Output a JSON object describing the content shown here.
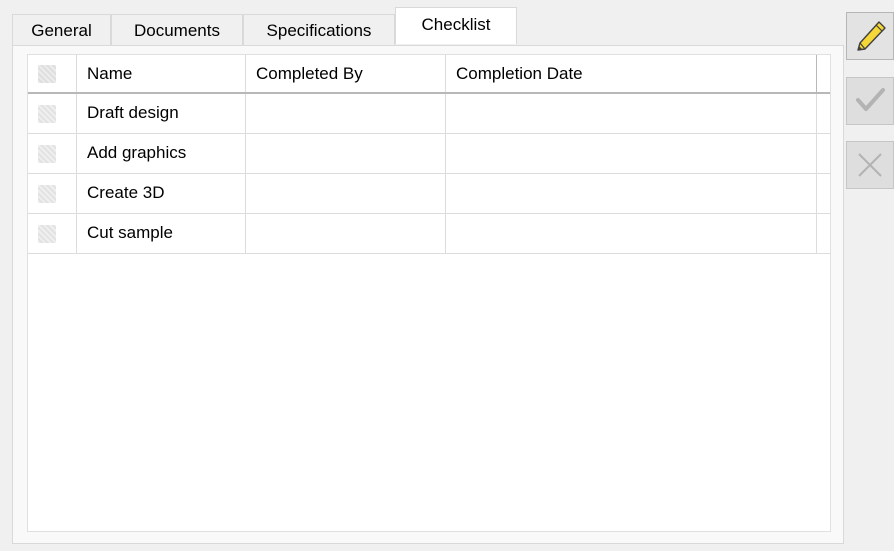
{
  "tabs": [
    {
      "label": "General",
      "active": false
    },
    {
      "label": "Documents",
      "active": false
    },
    {
      "label": "Specifications",
      "active": false
    },
    {
      "label": "Checklist",
      "active": true
    }
  ],
  "grid": {
    "columns": [
      "Name",
      "Completed By",
      "Completion Date"
    ],
    "rows": [
      {
        "name": "Draft design",
        "completed_by": "",
        "completion_date": ""
      },
      {
        "name": "Add graphics",
        "completed_by": "",
        "completion_date": ""
      },
      {
        "name": "Create 3D",
        "completed_by": "",
        "completion_date": ""
      },
      {
        "name": "Cut sample",
        "completed_by": "",
        "completion_date": ""
      }
    ]
  },
  "toolbar": {
    "edit_icon": "pencil-icon",
    "accept_icon": "checkmark-icon",
    "cancel_icon": "x-icon",
    "edit_enabled": true,
    "accept_enabled": false,
    "cancel_enabled": false
  },
  "colors": {
    "active_tab_bg": "#ffffff",
    "grid_bg": "#ffffff",
    "disabled_icon": "#b5b5b5",
    "pencil_yellow": "#f5d838"
  }
}
